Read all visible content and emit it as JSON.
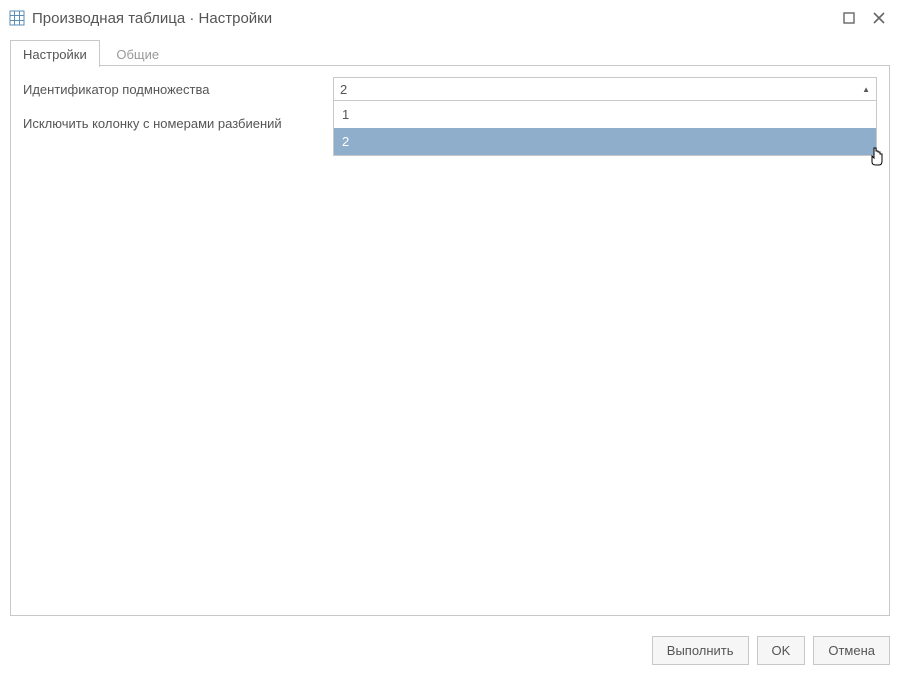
{
  "titlebar": {
    "title": "Производная таблица · Настройки"
  },
  "tabs": {
    "settings": "Настройки",
    "general": "Общие"
  },
  "form": {
    "subset_id_label": "Идентификатор подмножества",
    "exclude_col_label": "Исключить колонку с номерами разбиений",
    "combo_value": "2"
  },
  "dropdown": {
    "options": [
      "1",
      "2"
    ],
    "highlighted_index": 1
  },
  "footer": {
    "run": "Выполнить",
    "ok": "OK",
    "cancel": "Отмена"
  }
}
